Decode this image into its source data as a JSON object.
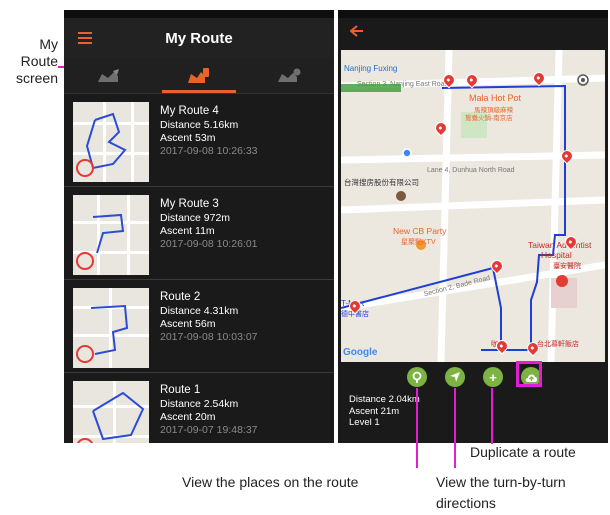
{
  "callouts": {
    "my_route_screen_line1": "My",
    "my_route_screen_line2": "Route",
    "my_route_screen_line3": "screen",
    "duplicate": "Duplicate a route",
    "view_places": "View the places on the route",
    "directions_line1": "View the turn-by-turn",
    "directions_line2": "directions"
  },
  "left_screen": {
    "title": "My Route",
    "routes": [
      {
        "name": "My Route 4",
        "distance": "Distance  5.16km",
        "ascent": "Ascent  53m",
        "date": "2017-09-08 10:26:33"
      },
      {
        "name": "My Route 3",
        "distance": "Distance  972m",
        "ascent": "Ascent  11m",
        "date": "2017-09-08 10:26:01"
      },
      {
        "name": "Route 2",
        "distance": "Distance  4.31km",
        "ascent": "Ascent  56m",
        "date": "2017-09-08 10:03:07"
      },
      {
        "name": "Route 1",
        "distance": "Distance  2.54km",
        "ascent": "Ascent  20m",
        "date": "2017-09-07 19:48:37"
      }
    ]
  },
  "right_screen": {
    "map_labels": {
      "nanjing_fuxing": "Nanjing Fuxing",
      "section3": "Section 3, Nanjing East Road",
      "mala_hot_pot": "Mala Hot Pot",
      "mala_cn1": "馬辣頂級麻辣",
      "mala_cn2": "鴛鴦火鍋-南京店",
      "lane4": "Lane 4, Dunhua North Road",
      "company_cn": "台灣搜房股份有限公司",
      "new_cb_party": "New CB Party",
      "ktv_cn": "星聚點KTV",
      "taiwan_adventist": "Taiwan Adventist",
      "hospital": "Hospital",
      "hospital_cn": "臺安醫院",
      "section2": "Section 2, Bade Road",
      "tmart": "T-Mart",
      "tmart_cn": "德中書店",
      "hotel_cn": "台北慕軒飯店",
      "cafe_cn": "咖啡",
      "google": "Google"
    },
    "stats": {
      "distance": "Distance  2.04km",
      "ascent": "Ascent  21m",
      "level": "Level  1"
    }
  },
  "colors": {
    "accent": "#e8632b",
    "callout": "#e020d0",
    "action_green": "#7cb342",
    "route_blue": "#1e3fd6"
  }
}
